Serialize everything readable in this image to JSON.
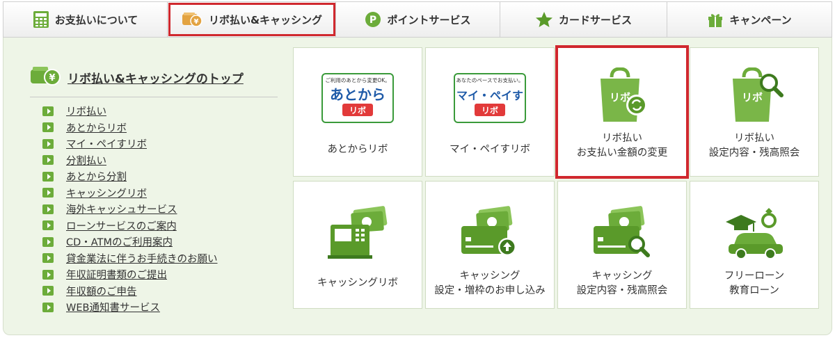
{
  "tabs": [
    {
      "label": "お支払いについて",
      "icon": "calculator-icon"
    },
    {
      "label": "リボ払い&キャッシング",
      "icon": "wallet-yen-icon",
      "active": true
    },
    {
      "label": "ポイントサービス",
      "icon": "point-p-icon"
    },
    {
      "label": "カードサービス",
      "icon": "star-icon"
    },
    {
      "label": "キャンペーン",
      "icon": "gift-icon"
    }
  ],
  "sidebar": {
    "title": "リボ払い&キャッシングのトップ",
    "items": [
      {
        "label": "リボ払い"
      },
      {
        "label": "あとからリボ"
      },
      {
        "label": "マイ・ペイすリボ"
      },
      {
        "label": "分割払い"
      },
      {
        "label": "あとから分割"
      },
      {
        "label": "キャッシングリボ"
      },
      {
        "label": "海外キャッシュサービス"
      },
      {
        "label": "ローンサービスのご案内"
      },
      {
        "label": "CD・ATMのご利用案内"
      },
      {
        "label": "貸金業法に伴うお手続きのお願い"
      },
      {
        "label": "年収証明書類のご提出"
      },
      {
        "label": "年収額のご申告"
      },
      {
        "label": "WEB通知書サービス"
      }
    ]
  },
  "tiles": [
    {
      "line1": "あとからリボ",
      "line2": "",
      "icon": "atokara-ribo-logo",
      "logo_top": "ご利用のあとから変更OK。",
      "logo_main": "あとから",
      "logo_sub": "リボ"
    },
    {
      "line1": "マイ・ペイすリボ",
      "line2": "",
      "icon": "my-pay-su-ribo-logo",
      "logo_top": "あなたのペースでお支払い。",
      "logo_main": "マイ・ペイす",
      "logo_sub": "リボ"
    },
    {
      "line1": "リボ払い",
      "line2": "お支払い金額の変更",
      "icon": "ribo-bag-change-icon",
      "bag_text": "リボ",
      "selected": true
    },
    {
      "line1": "リボ払い",
      "line2": "設定内容・残高照会",
      "icon": "ribo-bag-search-icon",
      "bag_text": "リボ"
    },
    {
      "line1": "キャッシングリボ",
      "line2": "",
      "icon": "atm-cash-icon"
    },
    {
      "line1": "キャッシング",
      "line2": "設定・増枠のお申し込み",
      "icon": "card-cash-up-icon"
    },
    {
      "line1": "キャッシング",
      "line2": "設定内容・残高照会",
      "icon": "card-cash-search-icon"
    },
    {
      "line1": "フリーローン",
      "line2": "教育ローン",
      "icon": "car-graduation-ring-icon"
    }
  ],
  "colors": {
    "accent_green": "#6cac3a",
    "highlight_red": "#d0282e",
    "panel_bg": "#eef5e7"
  }
}
